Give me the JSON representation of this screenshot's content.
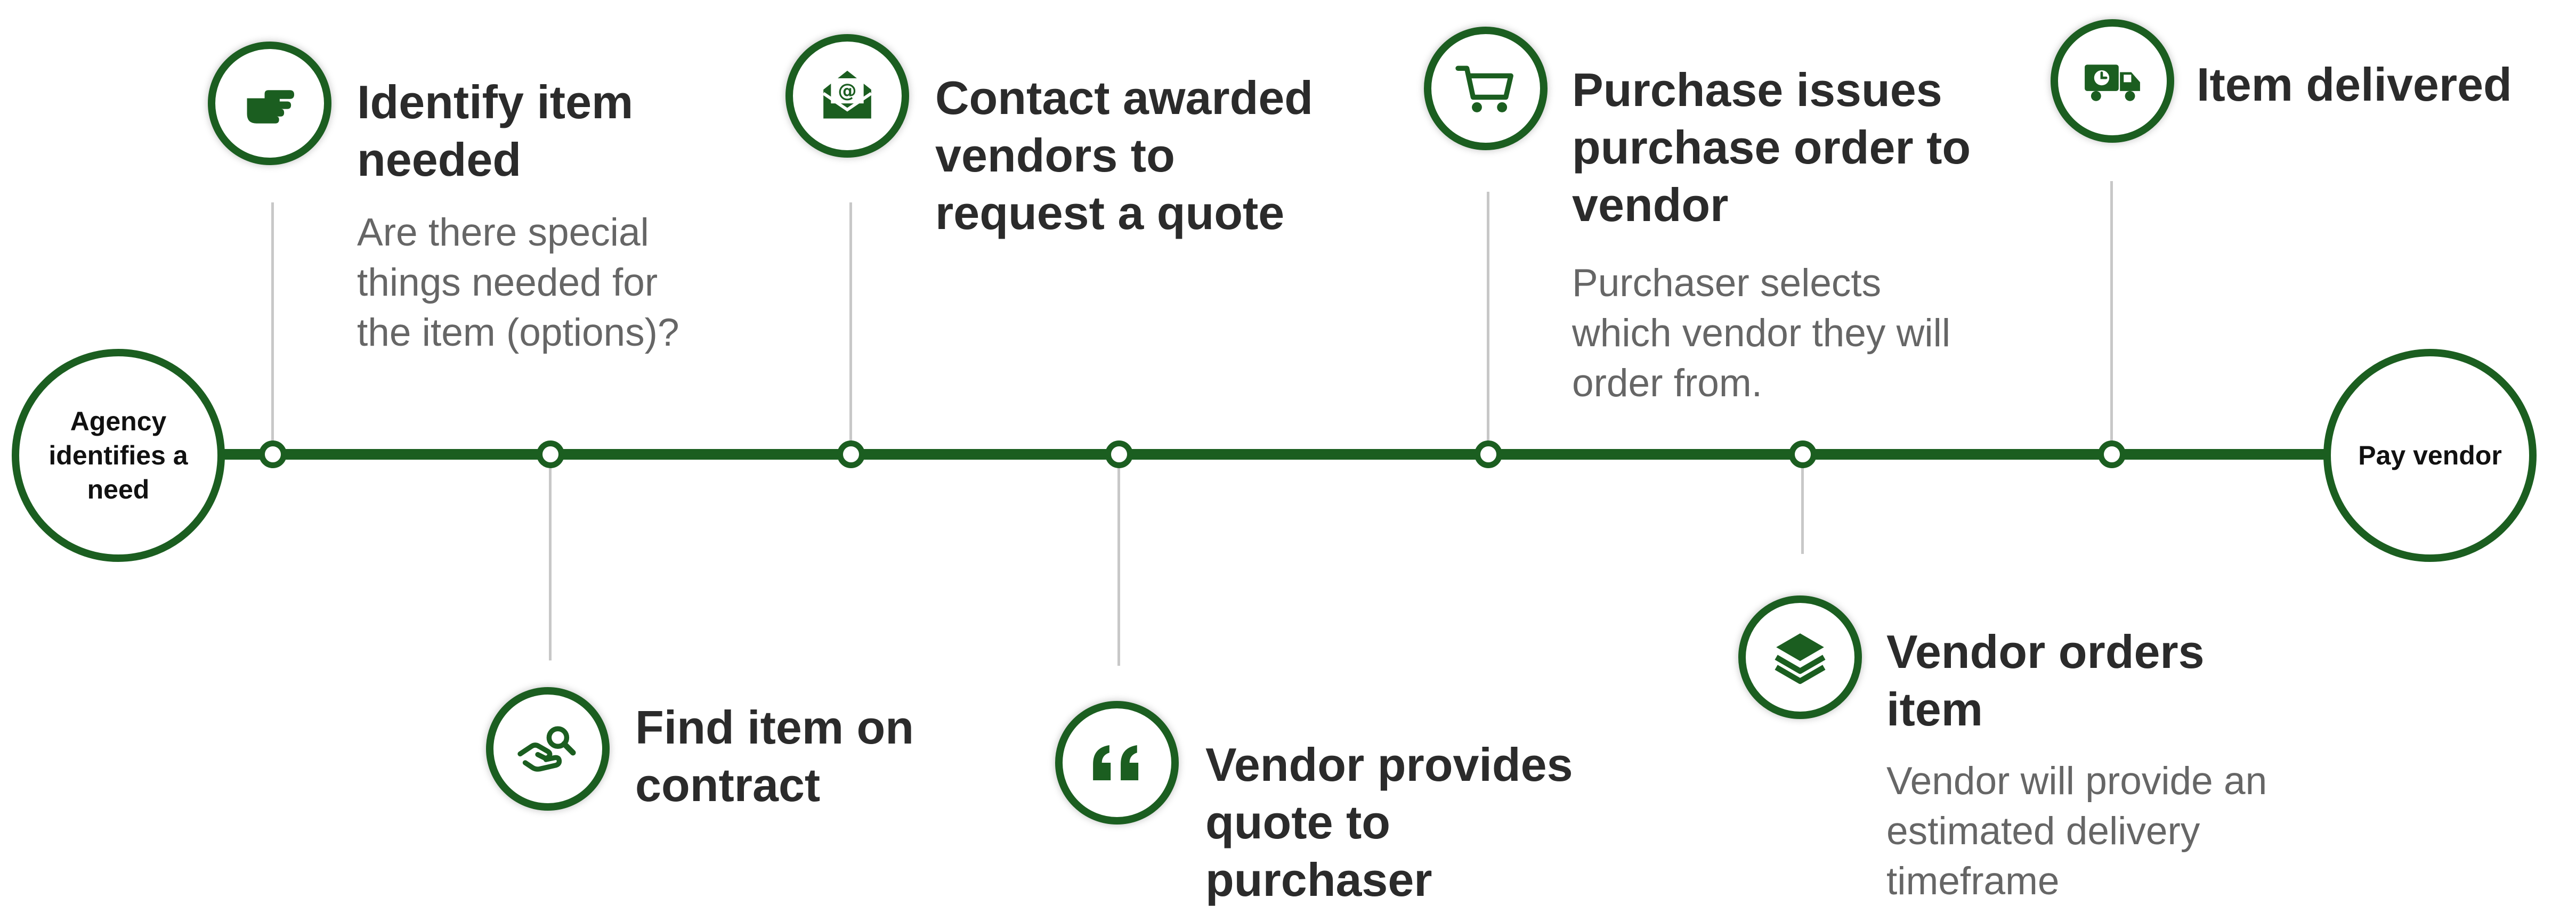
{
  "colors": {
    "primary": "#1b5e20",
    "connector": "#c8c8c8",
    "title": "#2b2b2b",
    "description": "#666666"
  },
  "start": {
    "label": "Agency identifies a need"
  },
  "end": {
    "label": "Pay vendor"
  },
  "steps": [
    {
      "icon": "pointing-hand-icon",
      "title": "Identify item needed",
      "description": "Are there special things needed for the item (options)?"
    },
    {
      "icon": "hand-search-icon",
      "title": "Find item on contract",
      "description": ""
    },
    {
      "icon": "envelope-at-icon",
      "title": "Contact awarded vendors to request a quote",
      "description": ""
    },
    {
      "icon": "quote-icon",
      "title": "Vendor provides quote to purchaser",
      "description": ""
    },
    {
      "icon": "shopping-cart-icon",
      "title": "Purchase issues purchase order to vendor",
      "description": "Purchaser selects which vendor they will order from."
    },
    {
      "icon": "layers-icon",
      "title": "Vendor orders item",
      "description": "Vendor will provide an estimated delivery timeframe"
    },
    {
      "icon": "delivery-truck-icon",
      "title": "Item delivered",
      "description": ""
    }
  ]
}
